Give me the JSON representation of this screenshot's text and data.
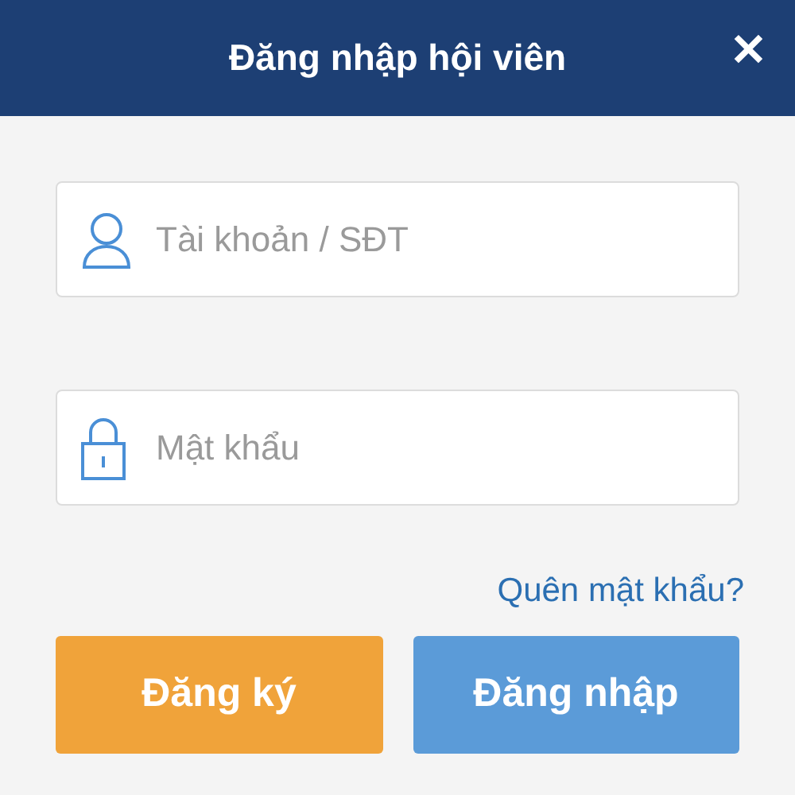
{
  "header": {
    "title": "Đăng nhập hội viên",
    "close": "✕"
  },
  "fields": [
    {
      "kind": "user",
      "placeholder": "Tài khoản / SĐT"
    },
    {
      "kind": "lock",
      "placeholder": "Mật khẩu"
    }
  ],
  "forgot_link": "Quên mật khẩu?",
  "buttons": [
    {
      "kind": "register",
      "label": "Đăng ký"
    },
    {
      "kind": "login",
      "label": "Đăng nhập"
    }
  ]
}
